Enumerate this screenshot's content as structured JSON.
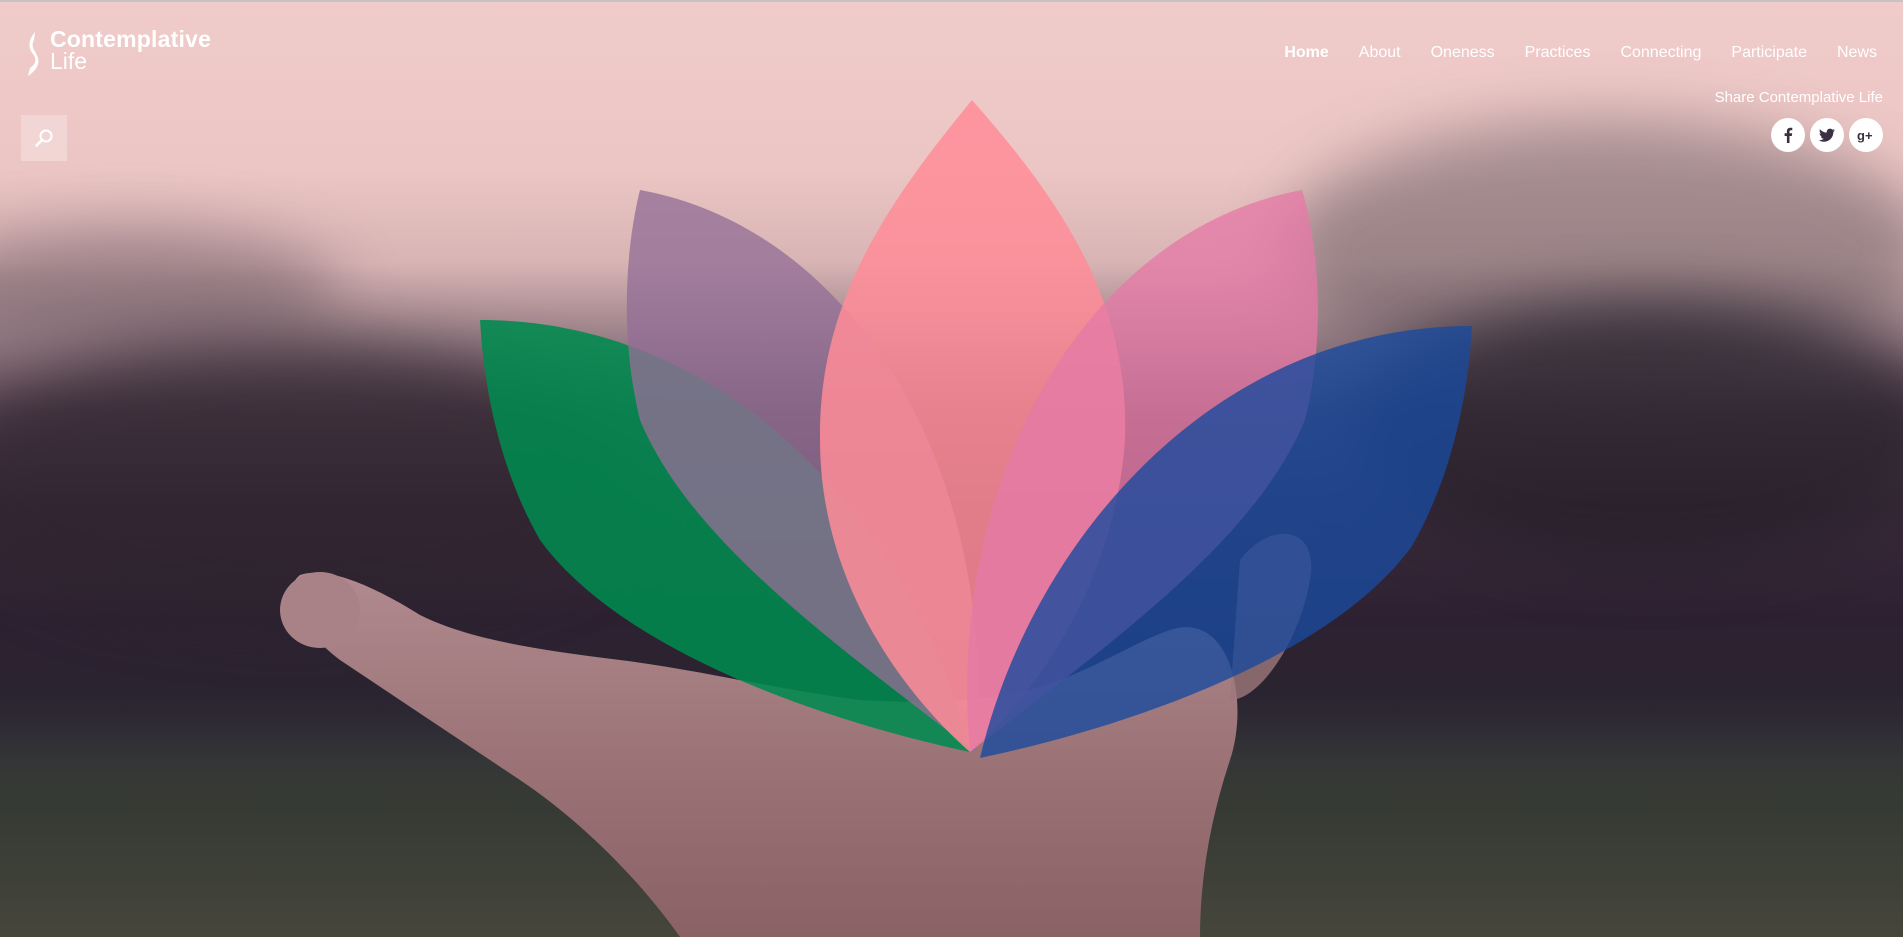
{
  "brand": {
    "line1": "Contemplative",
    "line2": "Life"
  },
  "nav": {
    "items": [
      {
        "label": "Home",
        "active": true
      },
      {
        "label": "About",
        "active": false
      },
      {
        "label": "Oneness",
        "active": false
      },
      {
        "label": "Practices",
        "active": false
      },
      {
        "label": "Connecting",
        "active": false
      },
      {
        "label": "Participate",
        "active": false
      },
      {
        "label": "News",
        "active": false
      }
    ]
  },
  "share": {
    "label": "Share Contemplative Life",
    "buttons": [
      {
        "icon": "facebook-icon"
      },
      {
        "icon": "twitter-icon"
      },
      {
        "icon": "google-plus-icon"
      }
    ]
  },
  "search": {
    "icon": "search-icon"
  },
  "hero": {
    "lotus_colors": [
      "#0a8a4a",
      "#8a6a9a",
      "#ff8a96",
      "#e07aa8",
      "#0b4a9a"
    ]
  }
}
